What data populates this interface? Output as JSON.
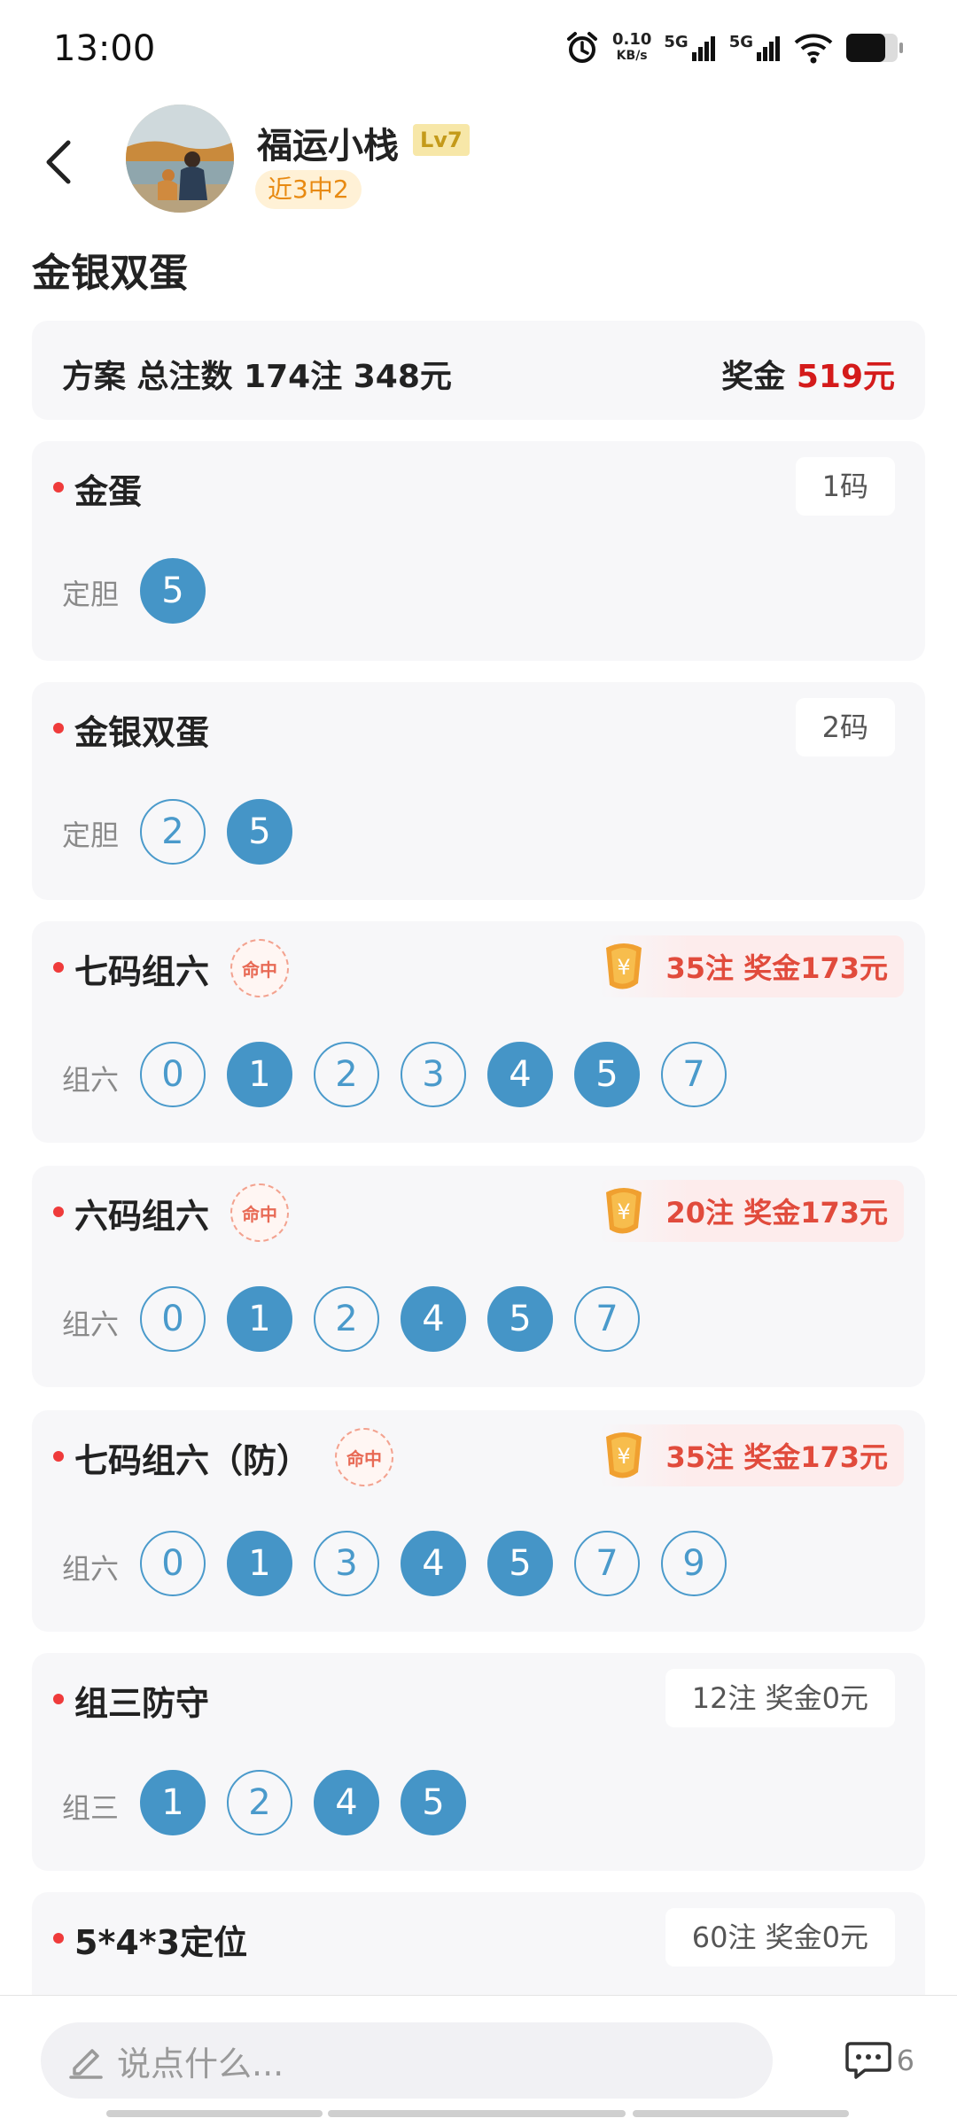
{
  "status_bar": {
    "time": "13:00",
    "net_speed": "0.10",
    "net_unit": "KB/s",
    "sig1": "5G",
    "sig2": "5G"
  },
  "header": {
    "username": "福运小栈",
    "level": "Lv7",
    "record": "近3中2"
  },
  "page_title": "金银双蛋",
  "plan": {
    "label": "方案 总注数 174注 348元",
    "prize_label": "奖金",
    "prize_amount": "519元"
  },
  "sections": [
    {
      "name": "金蛋",
      "pill": "1码",
      "row_label": "定胆",
      "balls": [
        {
          "n": "5",
          "on": true
        }
      ]
    },
    {
      "name": "金银双蛋",
      "pill": "2码",
      "row_label": "定胆",
      "balls": [
        {
          "n": "2",
          "on": false
        },
        {
          "n": "5",
          "on": true
        }
      ]
    },
    {
      "name": "七码组六",
      "stamp": "命中",
      "hit": "35注  奖金173元",
      "row_label": "组六",
      "balls": [
        {
          "n": "0",
          "on": false
        },
        {
          "n": "1",
          "on": true
        },
        {
          "n": "2",
          "on": false
        },
        {
          "n": "3",
          "on": false
        },
        {
          "n": "4",
          "on": true
        },
        {
          "n": "5",
          "on": true
        },
        {
          "n": "7",
          "on": false
        }
      ]
    },
    {
      "name": "六码组六",
      "stamp": "命中",
      "hit": "20注  奖金173元",
      "row_label": "组六",
      "balls": [
        {
          "n": "0",
          "on": false
        },
        {
          "n": "1",
          "on": true
        },
        {
          "n": "2",
          "on": false
        },
        {
          "n": "4",
          "on": true
        },
        {
          "n": "5",
          "on": true
        },
        {
          "n": "7",
          "on": false
        }
      ]
    },
    {
      "name": "七码组六（防）",
      "stamp": "命中",
      "hit": "35注  奖金173元",
      "row_label": "组六",
      "balls": [
        {
          "n": "0",
          "on": false
        },
        {
          "n": "1",
          "on": true
        },
        {
          "n": "3",
          "on": false
        },
        {
          "n": "4",
          "on": true
        },
        {
          "n": "5",
          "on": true
        },
        {
          "n": "7",
          "on": false
        },
        {
          "n": "9",
          "on": false
        }
      ]
    },
    {
      "name": "组三防守",
      "pill": "12注  奖金0元",
      "row_label": "组三",
      "balls": [
        {
          "n": "1",
          "on": true
        },
        {
          "n": "2",
          "on": false
        },
        {
          "n": "4",
          "on": true
        },
        {
          "n": "5",
          "on": true
        }
      ]
    },
    {
      "name": "5*4*3定位",
      "pill": "60注  奖金0元"
    }
  ],
  "bottom_bar": {
    "placeholder": "说点什么...",
    "comment_count": "6"
  },
  "colors": {
    "accent_blue": "#4595c7",
    "prize_red": "#d41b1b",
    "hit_red": "#e14b3c",
    "dot_red": "#ef3b3b"
  }
}
